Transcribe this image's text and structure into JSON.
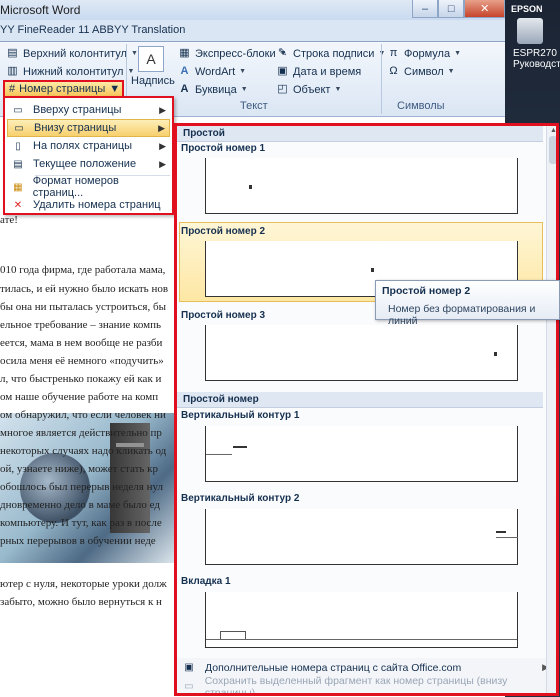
{
  "window": {
    "title": "Microsoft Word",
    "controls": [
      "–",
      "□",
      "✕"
    ]
  },
  "tabs": [
    "YY FineReader 11",
    "ABBYY Translation"
  ],
  "ribbon": {
    "header_footer": {
      "header_label": "Верхний колонтитул",
      "footer_label": "Нижний колонтитул",
      "page_number_label": "Номер страницы"
    },
    "caption": {
      "label": "Надпись"
    },
    "text_group": {
      "label": "Текст",
      "quick_parts": "Экспресс-блоки",
      "wordart": "WordArt",
      "dropcap": "Буквица",
      "signature_line": "Строка подписи",
      "date_time": "Дата и время",
      "object": "Объект"
    },
    "symbols_group": {
      "label": "Символы",
      "formula": "Формула",
      "symbol": "Символ"
    }
  },
  "desktop": {
    "label1": "EPSON",
    "label2": "ESPR270 Руководст..."
  },
  "document": {
    "lines": [
      "ате!",
      "010 года фирма, где работала мама,",
      "тилась, и ей нужно было искать нов",
      "бы она ни пыталась устроиться, бы",
      "ельное требование – знание компь",
      "еется, мама в нем вообще не разби",
      "осила меня её немного «подучить»",
      "л, что быстренько покажу ей как и",
      "ом наше обучение работе на комп",
      "ом обнаружил, что если человек ни",
      "многое является действительно пр",
      "некоторых случаях надо кликать од",
      "ой, узнаете ниже), может стать кр",
      "обошлось был перерыв неделя нул",
      "дновременно дело в маме было ед",
      "компьютеру. И тут, как раз в после",
      "рных перерывов в обучении неде",
      "ютер с нуля, некоторые уроки долж",
      "забыто, можно было вернуться к н"
    ]
  },
  "submenu": {
    "items": [
      {
        "label": "Вверху страницы",
        "has_arrow": true,
        "highlighted": false,
        "icon": "page-top-icon"
      },
      {
        "label": "Внизу страницы",
        "has_arrow": true,
        "highlighted": true,
        "icon": "page-bottom-icon"
      },
      {
        "label": "На полях страницы",
        "has_arrow": true,
        "highlighted": false,
        "icon": "page-margin-icon"
      },
      {
        "label": "Текущее положение",
        "has_arrow": true,
        "highlighted": false,
        "icon": "current-position-icon"
      },
      {
        "label": "Формат номеров страниц...",
        "has_arrow": false,
        "highlighted": false,
        "icon": "format-numbers-icon"
      },
      {
        "label": "Удалить номера страниц",
        "has_arrow": false,
        "highlighted": false,
        "icon": "remove-numbers-icon"
      }
    ]
  },
  "gallery": {
    "category_simple": "Простой",
    "item1": "Простой номер 1",
    "item2": "Простой номер 2",
    "item3": "Простой номер 3",
    "category_plain": "Простой номер",
    "item4": "Вертикальный контур 1",
    "item5": "Вертикальный контур 2",
    "item6": "Вкладка 1",
    "footer_more": "Дополнительные номера страниц с сайта Office.com",
    "footer_save": "Сохранить выделенный фрагмент как номер страницы (внизу страницы)"
  },
  "tooltip": {
    "title": "Простой номер 2",
    "description": "Номер без форматирования и линий"
  }
}
